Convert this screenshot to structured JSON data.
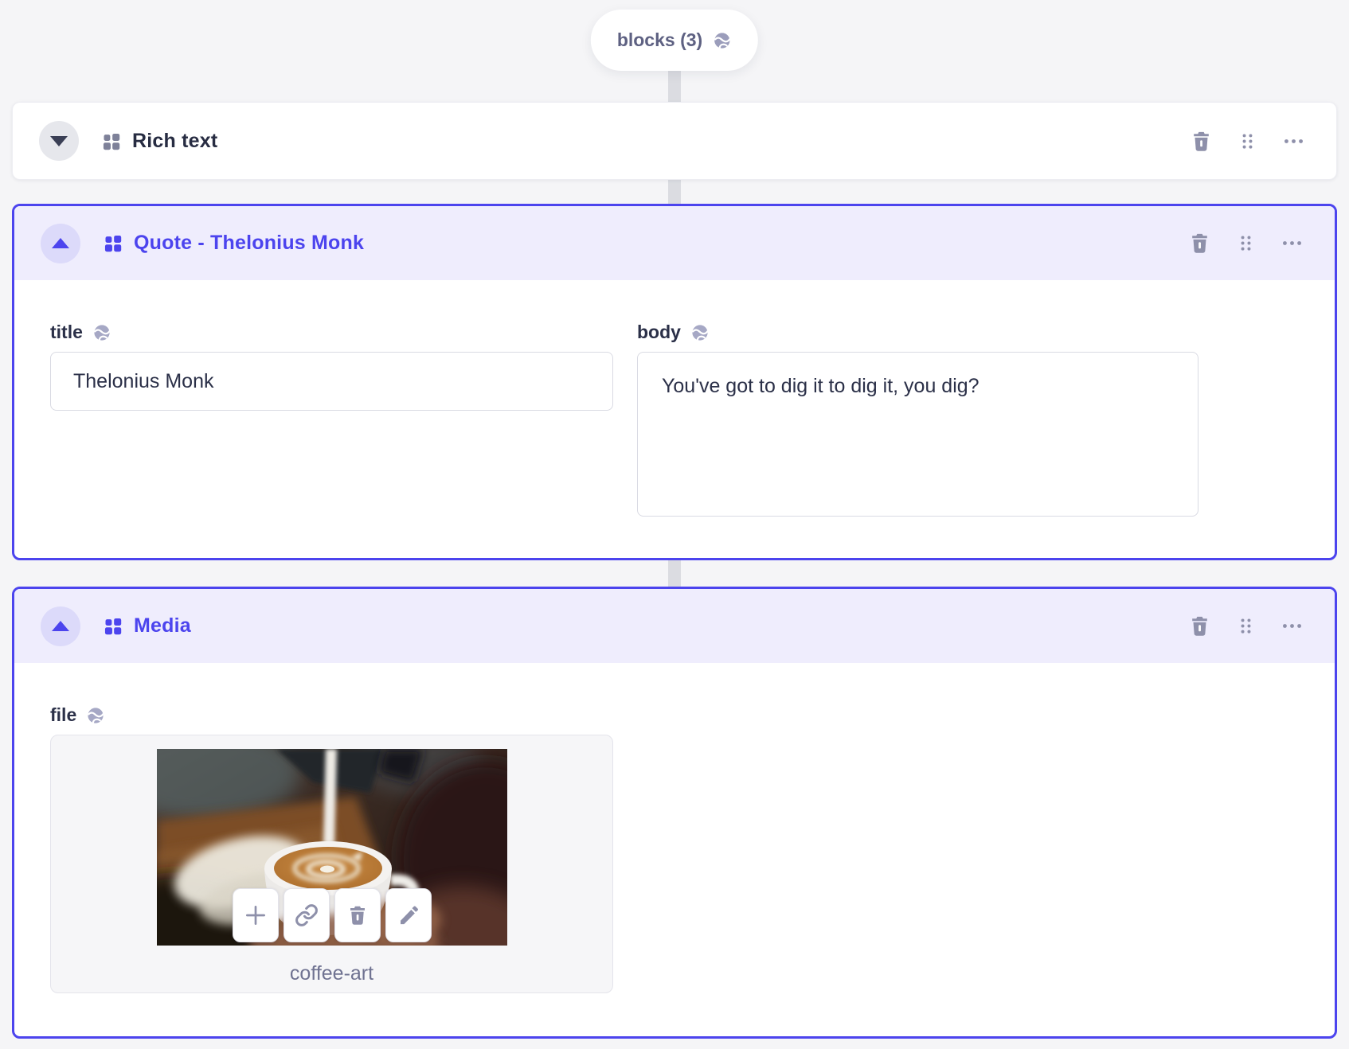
{
  "colors": {
    "accent": "#4c44ee",
    "accent_header_bg": "#efedfd",
    "accent_toggle_bg": "#dcdafa",
    "page_bg": "#f5f5f7",
    "connector": "#dbdce1",
    "icon_slate": "#8e90aa",
    "text_dark": "#272c42",
    "text_slate": "#5e6182",
    "input_border": "#d9dae3"
  },
  "pill": {
    "label": "blocks (3)",
    "icon": "globe-icon"
  },
  "blocks": [
    {
      "title": "Rich text",
      "state": "collapsed",
      "toggle_icon": "chevron-down-icon",
      "type_icon": "blocks-icon",
      "actions": {
        "delete": "trash-icon",
        "drag": "drag-handle-icon",
        "more": "ellipsis-icon"
      }
    },
    {
      "title": "Quote - Thelonius Monk",
      "state": "expanded",
      "toggle_icon": "chevron-up-icon",
      "type_icon": "blocks-icon",
      "actions": {
        "delete": "trash-icon",
        "drag": "drag-handle-icon",
        "more": "ellipsis-icon"
      },
      "fields": {
        "title": {
          "label": "title",
          "localized_icon": "globe-icon",
          "value": "Thelonius Monk"
        },
        "body": {
          "label": "body",
          "localized_icon": "globe-icon",
          "value": "You've got to dig it to dig it, you dig?"
        }
      }
    },
    {
      "title": "Media",
      "state": "expanded",
      "toggle_icon": "chevron-up-icon",
      "type_icon": "blocks-icon",
      "actions": {
        "delete": "trash-icon",
        "drag": "drag-handle-icon",
        "more": "ellipsis-icon"
      },
      "fields": {
        "file": {
          "label": "file",
          "localized_icon": "globe-icon",
          "filename": "coffee-art",
          "thumbnail": "coffee-latte-art-photo",
          "buttons": [
            {
              "icon": "plus-icon"
            },
            {
              "icon": "link-icon"
            },
            {
              "icon": "trash-icon"
            },
            {
              "icon": "pencil-icon"
            }
          ]
        }
      }
    }
  ]
}
